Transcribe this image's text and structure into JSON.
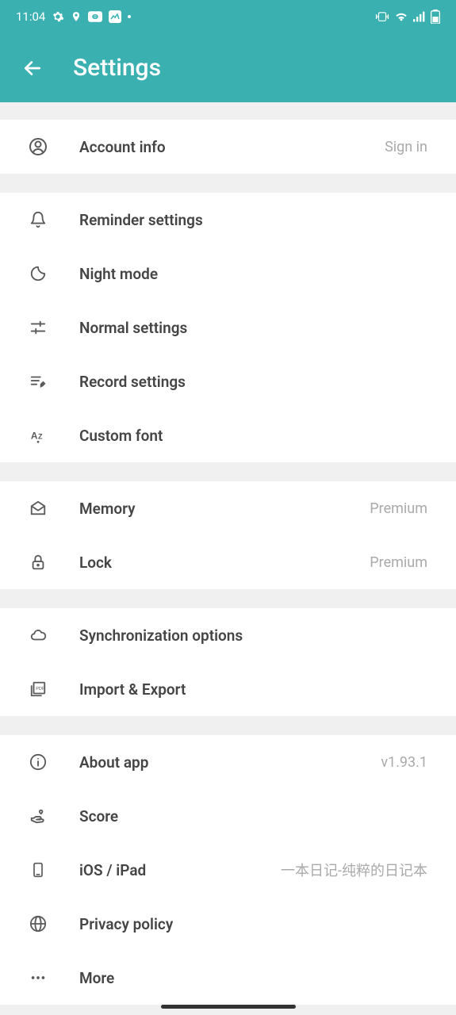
{
  "status_bar": {
    "time": "11:04"
  },
  "header": {
    "title": "Settings"
  },
  "items": {
    "account": {
      "label": "Account info",
      "tail": "Sign in"
    },
    "reminder": {
      "label": "Reminder settings"
    },
    "night": {
      "label": "Night mode"
    },
    "normal": {
      "label": "Normal settings"
    },
    "record": {
      "label": "Record settings"
    },
    "font": {
      "label": "Custom font"
    },
    "memory": {
      "label": "Memory",
      "tail": "Premium"
    },
    "lock": {
      "label": "Lock",
      "tail": "Premium"
    },
    "sync": {
      "label": "Synchronization options"
    },
    "import": {
      "label": "Import & Export"
    },
    "about": {
      "label": "About app",
      "tail": "v1.93.1"
    },
    "score": {
      "label": "Score"
    },
    "ios": {
      "label": "iOS / iPad",
      "tail": "一本日记-纯粹的日记本"
    },
    "privacy": {
      "label": "Privacy policy"
    },
    "more": {
      "label": "More"
    }
  }
}
